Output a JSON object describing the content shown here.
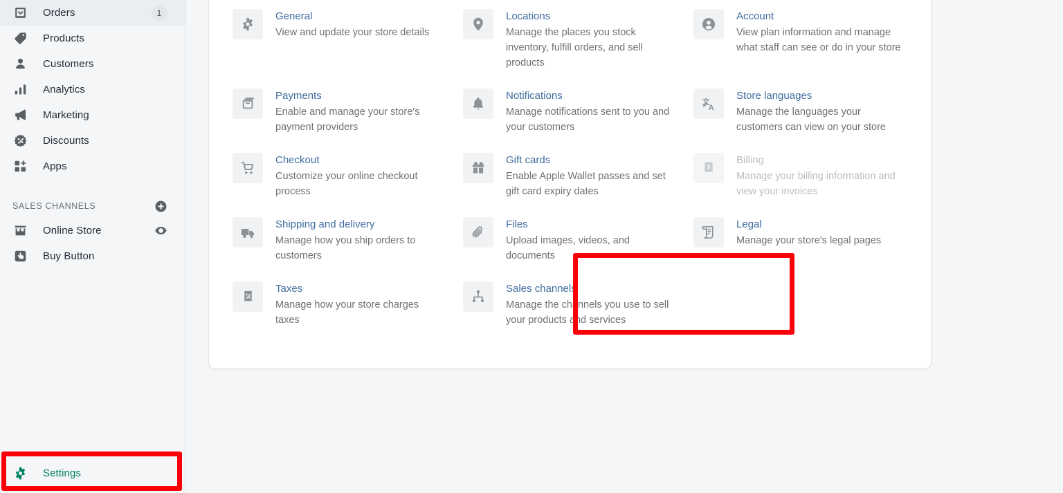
{
  "sidebar": {
    "items": [
      {
        "label": "Orders",
        "icon": "orders-icon",
        "badge": "1"
      },
      {
        "label": "Products",
        "icon": "products-icon",
        "badge": ""
      },
      {
        "label": "Customers",
        "icon": "customers-icon",
        "badge": ""
      },
      {
        "label": "Analytics",
        "icon": "analytics-icon",
        "badge": ""
      },
      {
        "label": "Marketing",
        "icon": "marketing-icon",
        "badge": ""
      },
      {
        "label": "Discounts",
        "icon": "discounts-icon",
        "badge": ""
      },
      {
        "label": "Apps",
        "icon": "apps-icon",
        "badge": ""
      }
    ],
    "sales_channels": {
      "title": "SALES CHANNELS",
      "add_icon": "plus-circle-icon",
      "items": [
        {
          "label": "Online Store",
          "icon": "storefront-icon",
          "trailing_icon": "eye-icon"
        },
        {
          "label": "Buy Button",
          "icon": "buy-button-icon",
          "trailing_icon": ""
        }
      ]
    },
    "settings": {
      "label": "Settings",
      "icon": "gear-icon",
      "color": "#008060"
    }
  },
  "main": {
    "settings_cards": [
      {
        "title": "General",
        "desc": "View and update your store details",
        "icon": "gear-icon",
        "disabled": false
      },
      {
        "title": "Locations",
        "desc": "Manage the places you stock inventory, fulfill orders, and sell products",
        "icon": "location-pin-icon",
        "disabled": false
      },
      {
        "title": "Account",
        "desc": "View plan information and manage what staff can see or do in your store",
        "icon": "account-icon",
        "disabled": false
      },
      {
        "title": "Payments",
        "desc": "Enable and manage your store's payment providers",
        "icon": "payments-icon",
        "disabled": false
      },
      {
        "title": "Notifications",
        "desc": "Manage notifications sent to you and your customers",
        "icon": "bell-icon",
        "disabled": false
      },
      {
        "title": "Store languages",
        "desc": "Manage the languages your customers can view on your store",
        "icon": "translate-icon",
        "disabled": false
      },
      {
        "title": "Checkout",
        "desc": "Customize your online checkout process",
        "icon": "cart-icon",
        "disabled": false
      },
      {
        "title": "Gift cards",
        "desc": "Enable Apple Wallet passes and set gift card expiry dates",
        "icon": "gift-card-icon",
        "disabled": false
      },
      {
        "title": "Billing",
        "desc": "Manage your billing information and view your invoices",
        "icon": "billing-receipt-icon",
        "disabled": true
      },
      {
        "title": "Shipping and delivery",
        "desc": "Manage how you ship orders to customers",
        "icon": "truck-icon",
        "disabled": false
      },
      {
        "title": "Files",
        "desc": "Upload images, videos, and documents",
        "icon": "paperclip-icon",
        "disabled": false
      },
      {
        "title": "Legal",
        "desc": "Manage your store's legal pages",
        "icon": "legal-scroll-icon",
        "disabled": false
      },
      {
        "title": "Taxes",
        "desc": "Manage how your store charges taxes",
        "icon": "tax-receipt-icon",
        "disabled": false
      },
      {
        "title": "Sales channels",
        "desc": "Manage the channels you use to sell your products and services",
        "icon": "sales-channels-icon",
        "disabled": false
      }
    ]
  },
  "annotations": {
    "color": "#fb0007",
    "highlighted_card": "Files",
    "highlighted_nav": "Settings"
  }
}
